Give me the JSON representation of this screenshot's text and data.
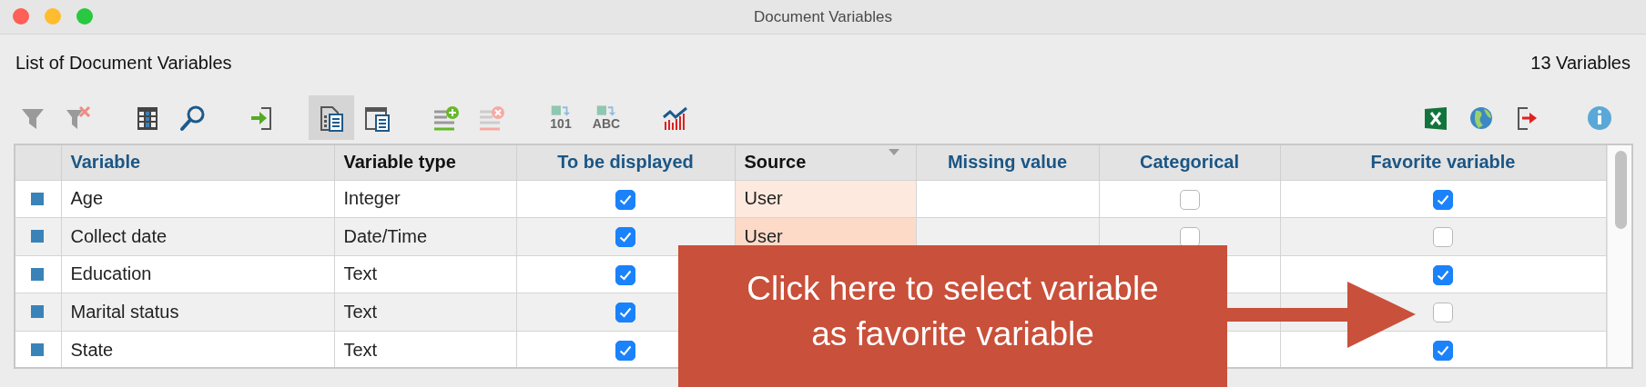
{
  "window": {
    "title": "Document Variables"
  },
  "header": {
    "title": "List of Document Variables",
    "count": "13 Variables"
  },
  "toolbar": {
    "left_groups": [
      [
        {
          "kind": "filter",
          "selected": false
        },
        {
          "kind": "unfilter",
          "selected": false
        }
      ],
      [
        {
          "kind": "columns",
          "selected": false
        },
        {
          "kind": "search",
          "selected": false
        }
      ],
      [
        {
          "kind": "import",
          "selected": false
        }
      ],
      [
        {
          "kind": "doclist",
          "selected": true
        },
        {
          "kind": "docwindow",
          "selected": false
        }
      ],
      [
        {
          "kind": "addrow",
          "selected": false
        },
        {
          "kind": "removerow",
          "selected": false
        }
      ],
      [
        {
          "kind": "convert",
          "label": "101",
          "selected": false
        },
        {
          "kind": "convert",
          "label": "ABC",
          "selected": false
        }
      ],
      [
        {
          "kind": "chart",
          "selected": false
        }
      ]
    ],
    "right": [
      {
        "kind": "excel",
        "selected": false
      },
      {
        "kind": "globe",
        "selected": false
      },
      {
        "kind": "exit",
        "selected": false
      },
      {
        "kind": "info",
        "selected": false
      }
    ]
  },
  "table": {
    "columns": [
      {
        "label": "Variable",
        "editable": true
      },
      {
        "label": "Variable type",
        "editable": false
      },
      {
        "label": "To be displayed",
        "editable": true
      },
      {
        "label": "Source",
        "editable": false,
        "sorted": true
      },
      {
        "label": "Missing value",
        "editable": true
      },
      {
        "label": "Categorical",
        "editable": true
      },
      {
        "label": "Favorite variable",
        "editable": true
      }
    ],
    "rows": [
      {
        "variable": "Age",
        "type": "Integer",
        "displayed": true,
        "source": "User",
        "categorical": false,
        "favorite": true
      },
      {
        "variable": "Collect date",
        "type": "Date/Time",
        "displayed": true,
        "source": "User",
        "categorical": false,
        "favorite": false
      },
      {
        "variable": "Education",
        "type": "Text",
        "displayed": true,
        "favorite": true
      },
      {
        "variable": "Marital status",
        "type": "Text",
        "displayed": true,
        "favorite": false
      },
      {
        "variable": "State",
        "type": "Text",
        "displayed": true,
        "favorite": true
      }
    ]
  },
  "callout": {
    "lines": [
      "Click here to select variable",
      "as favorite variable"
    ]
  }
}
